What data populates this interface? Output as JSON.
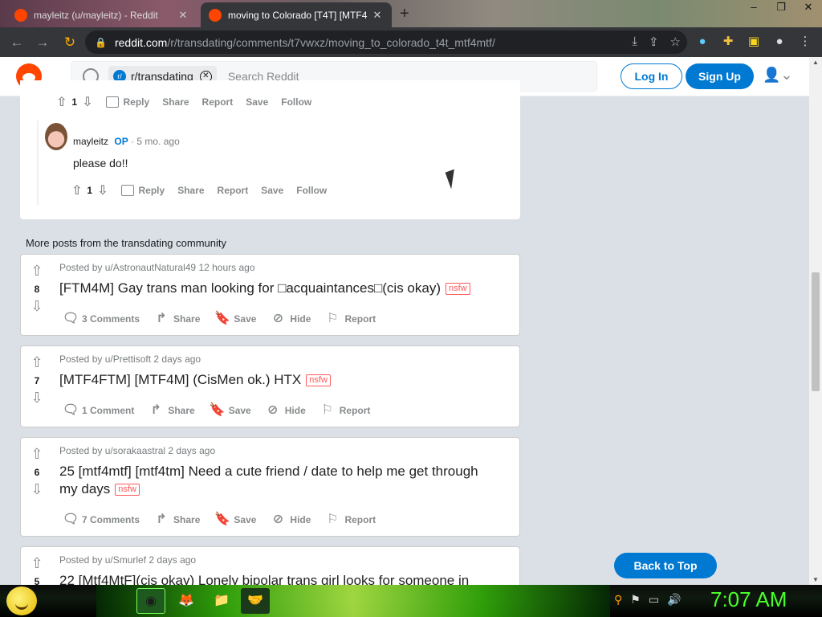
{
  "browser": {
    "tabs": [
      {
        "title": "mayleitz (u/mayleitz) - Reddit"
      },
      {
        "title": "moving to Colorado [T4T] [MTF4"
      }
    ],
    "new_tab": "+",
    "url_host": "reddit.com",
    "url_path": "/r/transdating/comments/t7vwxz/moving_to_colorado_t4t_mtf4mtf/"
  },
  "header": {
    "subreddit_chip": "r/transdating",
    "search_placeholder": "Search Reddit",
    "login_label": "Log In",
    "signup_label": "Sign Up"
  },
  "comment_actions_top": {
    "score": "1",
    "reply": "Reply",
    "share": "Share",
    "report": "Report",
    "save": "Save",
    "follow": "Follow"
  },
  "comment": {
    "author": "mayleitz",
    "op_badge": "OP",
    "time": "· 5 mo. ago",
    "body": "please do!!",
    "score": "1",
    "reply": "Reply",
    "share": "Share",
    "report": "Report",
    "save": "Save",
    "follow": "Follow"
  },
  "more_posts_title": "More posts from the transdating community",
  "posts": [
    {
      "score": "8",
      "meta": "Posted by u/AstronautNatural49 12 hours ago",
      "title": "[FTM4M] Gay trans man looking for □acquaintances□(cis okay)",
      "nsfw": "nsfw",
      "comments": "3 Comments",
      "share": "Share",
      "save": "Save",
      "hide": "Hide",
      "report": "Report"
    },
    {
      "score": "7",
      "meta": "Posted by u/Prettisoft 2 days ago",
      "title": "[MTF4FTM] [MTF4M] (CisMen ok.) HTX",
      "nsfw": "nsfw",
      "comments": "1 Comment",
      "share": "Share",
      "save": "Save",
      "hide": "Hide",
      "report": "Report"
    },
    {
      "score": "6",
      "meta": "Posted by u/sorakaastral 2 days ago",
      "title": "25 [mtf4mtf] [mtf4tm] Need a cute friend / date to help me get through my days",
      "nsfw": "nsfw",
      "comments": "7 Comments",
      "share": "Share",
      "save": "Save",
      "hide": "Hide",
      "report": "Report"
    },
    {
      "score": "5",
      "meta": "Posted by u/Smurlef 2 days ago",
      "title": "22 [Mtf4MtF](cis okay) Lonely bipolar trans girl looks for someone in"
    }
  ],
  "back_to_top": "Back to Top",
  "taskbar": {
    "clock": "7:07 AM"
  },
  "colors": {
    "reddit_orange": "#ff4500",
    "reddit_blue": "#0079d3",
    "nsfw_red": "#ff585b",
    "clock_green": "#4aff2a"
  }
}
